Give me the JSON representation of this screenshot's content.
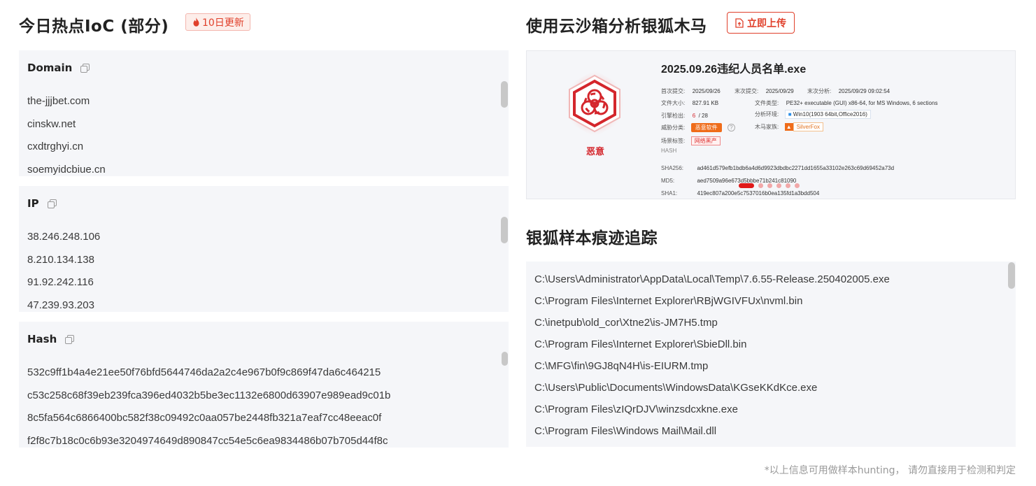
{
  "left": {
    "title": "今日热点IoC (部分)",
    "badge": "10日更新",
    "panels": {
      "domain": {
        "title": "Domain",
        "items": [
          "the-jjjbet.com",
          "cinskw.net",
          "cxdtrghyi.cn",
          "soemyidcbiue.cn"
        ]
      },
      "ip": {
        "title": "IP",
        "items": [
          "38.246.248.106",
          "8.210.134.138",
          "91.92.242.116",
          "47.239.93.203"
        ]
      },
      "hash": {
        "title": "Hash",
        "items": [
          "532c9ff1b4a4e21ee50f76bfd5644746da2a2c4e967b0f9c869f47da6c464215",
          "c53c258c68f39eb239fca396ed4032b5be3ec1132e6800d63907e989ead9c01b",
          "8c5fa564c6866400bc582f38c09492c0aa057be2448fb321a7eaf7cc48eeac0f",
          "f2f8c7b18c0c6b93e3204974649d890847cc54e5c6ea9834486b07b705d44f8c"
        ]
      }
    }
  },
  "right": {
    "title": "使用云沙箱分析银狐木马",
    "upload_label": "立即上传",
    "report": {
      "verdict": "恶意",
      "filename": "2025.09.26违纪人员名单.exe",
      "first_submit_label": "首次提交:",
      "first_submit": "2025/09/26",
      "last_submit_label": "末次提交:",
      "last_submit": "2025/09/29",
      "last_analysis_label": "末次分析:",
      "last_analysis": "2025/09/29 09:02:54",
      "size_label": "文件大小:",
      "size": "827.91 KB",
      "type_label": "文件类型:",
      "type": "PE32+ executable (GUI) x86-64, for MS Windows, 6 sections",
      "engine_label": "引擎检出:",
      "engine_hit": "6",
      "engine_total": "/ 28",
      "env_label": "分析环境:",
      "env": "Win10(1903 64bit,Office2016)",
      "threat_label": "威胁分类:",
      "threat": "恶意软件",
      "family_label": "木马家族:",
      "family": "SilverFox",
      "scene_label": "场景标签:",
      "scene": "网络黑产",
      "hash_header": "HASH",
      "sha256_label": "SHA256:",
      "sha256": "ad461d579efb1bdb6a4d6d9923dbdbc2271dd1655a33102e263c69d69452a73d",
      "md5_label": "MD5:",
      "md5": "aed7509a96e673d5bbbe71b241c81090",
      "sha1_label": "SHA1:",
      "sha1": "419ec807a200e5c7537016b0ea135fd1a3bdd504"
    },
    "trace_title": "银狐样本痕迹追踪",
    "trace_items": [
      "C:\\Users\\Administrator\\AppData\\Local\\Temp\\7.6.55-Release.250402005.exe",
      "C:\\Program Files\\Internet Explorer\\RBjWGIVFUx\\nvml.bin",
      "C:\\inetpub\\old_cor\\Xtne2\\is-JM7H5.tmp",
      "C:\\Program Files\\Internet Explorer\\SbieDll.bin",
      "C:\\MFG\\fin\\9GJ8qN4H\\is-EIURM.tmp",
      "C:\\Users\\Public\\Documents\\WindowsData\\KGseKKdKce.exe",
      "C:\\Program Files\\zIQrDJV\\winzsdcxkne.exe",
      "C:\\Program Files\\Windows Mail\\Mail.dll"
    ]
  },
  "footer": "*以上信息可用做样本hunting， 请勿直接用于检测和判定",
  "colors": {
    "accent_red": "#e0402b",
    "panel_bg": "#f5f6f9"
  }
}
